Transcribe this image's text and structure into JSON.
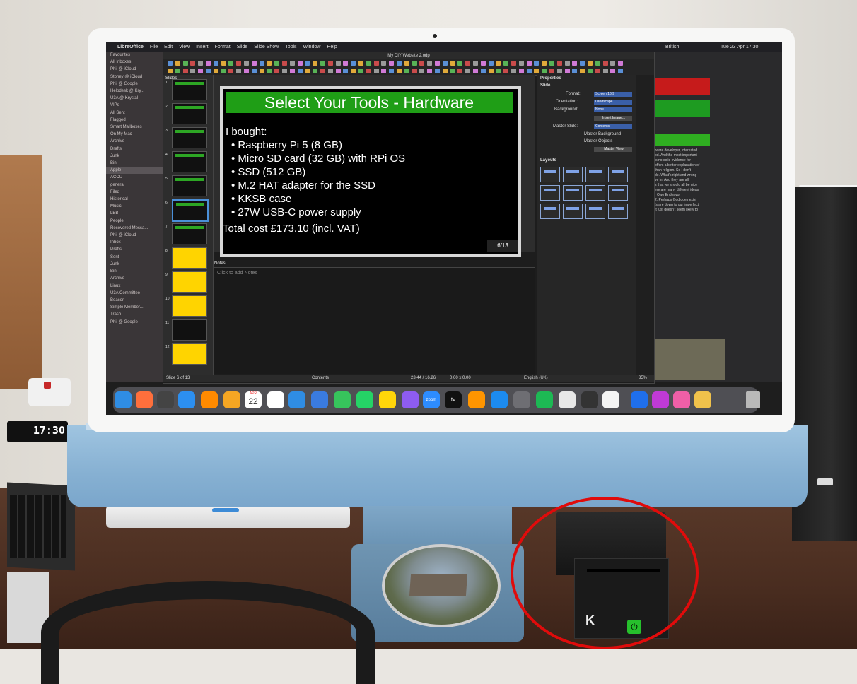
{
  "clock": {
    "time": "17:30"
  },
  "device": {
    "logo": "K",
    "power_symbol": "⏻"
  },
  "screen": {
    "menubar": {
      "app": "LibreOffice",
      "items": [
        "File",
        "Edit",
        "View",
        "Insert",
        "Format",
        "Slide",
        "Slide Show",
        "Tools",
        "Window",
        "Help"
      ],
      "right": [
        "British",
        "Tue 23 Apr  17:30"
      ]
    },
    "mail_sidebar": {
      "items": [
        {
          "label": "Favourites"
        },
        {
          "label": "All Inboxes"
        },
        {
          "label": "Phil @ iCloud"
        },
        {
          "label": "Stoney @ iCloud"
        },
        {
          "label": "Phil @ Google"
        },
        {
          "label": "Helpdesk @ Kry..."
        },
        {
          "label": "U3A @ Krystal"
        },
        {
          "label": "VIPs"
        },
        {
          "label": "All Sent"
        },
        {
          "label": "Flagged"
        },
        {
          "label": "Smart Mailboxes"
        },
        {
          "label": "On My Mac"
        },
        {
          "label": "Archive"
        },
        {
          "label": "Drafts"
        },
        {
          "label": "Junk"
        },
        {
          "label": "Bin"
        },
        {
          "label": "Apple",
          "selected": true
        },
        {
          "label": "ACCU"
        },
        {
          "label": "general"
        },
        {
          "label": "Filed"
        },
        {
          "label": "Historical"
        },
        {
          "label": "Music"
        },
        {
          "label": "LBB"
        },
        {
          "label": "People"
        },
        {
          "label": "Recovered Messa..."
        },
        {
          "label": "Phil @ iCloud"
        },
        {
          "label": "Inbox"
        },
        {
          "label": "Drafts"
        },
        {
          "label": "Sent"
        },
        {
          "label": "Junk"
        },
        {
          "label": "Bin"
        },
        {
          "label": "Archive"
        },
        {
          "label": "Linux"
        },
        {
          "label": "U3A Committee"
        },
        {
          "label": "Beacon"
        },
        {
          "label": "Simple Member..."
        },
        {
          "label": "Trash"
        },
        {
          "label": "Phil @ Google"
        }
      ]
    },
    "libreoffice": {
      "title": "My DIY Website 2.odp",
      "slides_label": "Slides",
      "slide": {
        "title": "Select Your Tools - Hardware",
        "heading": "I bought:",
        "bullets": [
          "• Raspberry Pi 5 (8 GB)",
          "• Micro SD card (32 GB) with RPi OS",
          "• SSD (512 GB)",
          "• M.2 HAT adapter for the SSD",
          "• KKSB case",
          "• 27W USB-C power supply"
        ],
        "total": "Total cost £173.10 (incl. VAT)",
        "number": "6/13"
      },
      "thumb_numbers": [
        "1",
        "2",
        "3",
        "4",
        "5",
        "6",
        "7",
        "8",
        "9",
        "10",
        "11",
        "12"
      ],
      "notes_label": "Notes",
      "notes_placeholder": "Click to add Notes",
      "properties": {
        "title": "Properties",
        "section": "Slide",
        "format_label": "Format:",
        "format_value": "Screen 16:9",
        "orientation_label": "Orientation:",
        "orientation_value": "Landscape",
        "background_label": "Background:",
        "background_value": "None",
        "insert_image": "Insert Image...",
        "master_slide_label": "Master Slide:",
        "master_slide_value": "Contents",
        "master_background": "Master Background",
        "master_objects": "Master Objects",
        "master_view": "Master View",
        "layouts_label": "Layouts"
      },
      "status": {
        "slide": "Slide 6 of 13",
        "master": "Contents",
        "position": "23.44 / 16.26",
        "size": "0.00 x 0.00",
        "language": "English (UK)",
        "zoom": "85%"
      }
    },
    "background_window_text": [
      "tware developer, interested",
      "od. And the most important",
      "is no solid evidence for",
      "offers a better explanation of",
      "than religion. So I don't",
      "de. What's right and wrong",
      "ve in. And they are all",
      "s that we should all be nice",
      "ere are many different ideas",
      "r Own Endeavor",
      "2. Perhaps God does exist",
      "fs are down to our imperfect",
      "It just doesn't seem likely to"
    ],
    "dock_calendar": {
      "month": "APR",
      "day": "22"
    },
    "dock_labels": [
      "zoom",
      "tv"
    ]
  }
}
